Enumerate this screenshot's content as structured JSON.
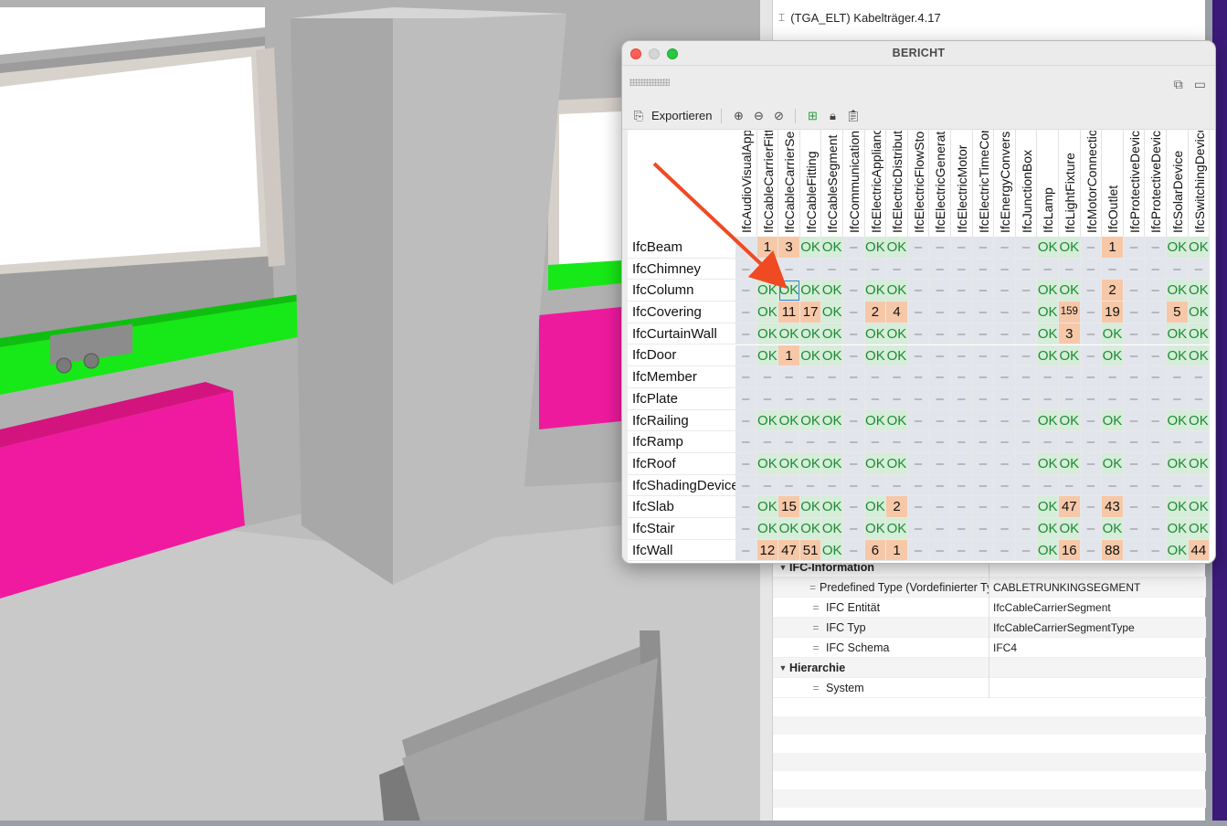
{
  "side_panel": {
    "tree_top_item": "(TGA_ELT) Kabelträger.4.17",
    "properties": [
      {
        "type": "group",
        "label": "IFC-Information"
      },
      {
        "type": "prop",
        "key": "Predefined Type (Vordefinierter Typ)",
        "value": "CABLETRUNKINGSEGMENT"
      },
      {
        "type": "prop",
        "key": "IFC Entität",
        "value": "IfcCableCarrierSegment"
      },
      {
        "type": "prop",
        "key": "IFC Typ",
        "value": "IfcCableCarrierSegmentType"
      },
      {
        "type": "prop",
        "key": "IFC Schema",
        "value": "IFC4"
      },
      {
        "type": "group",
        "label": "Hierarchie"
      },
      {
        "type": "prop",
        "key": "System",
        "value": ""
      }
    ]
  },
  "bericht": {
    "title": "BERICHT",
    "toolbar": {
      "export_label": "Exportieren"
    },
    "columns": [
      "IfcAudioVisualAppliance",
      "IfcCableCarrierFitting",
      "IfcCableCarrierSegment",
      "IfcCableFitting",
      "IfcCableSegment",
      "IfcCommunicationsAppliance",
      "IfcElectricAppliance",
      "IfcElectricDistributionBoard",
      "IfcElectricFlowStorageDevice",
      "IfcElectricGenerator",
      "IfcElectricMotor",
      "IfcElectricTimeControl",
      "IfcEnergyConversionDevice",
      "IfcJunctionBox",
      "IfcLamp",
      "IfcLightFixture",
      "IfcMotorConnection",
      "IfcOutlet",
      "IfcProtectiveDevice",
      "IfcProtectiveDeviceTrippingUnit",
      "IfcSolarDevice",
      "IfcSwitchingDevice"
    ],
    "rows": [
      {
        "label": "IfcBeam",
        "cells": [
          "",
          "1",
          "3",
          "OK",
          "OK",
          "–",
          "OK",
          "OK",
          "–",
          "–",
          "–",
          "–",
          "–",
          "–",
          "OK",
          "OK",
          "–",
          "1",
          "–",
          "–",
          "OK",
          "OK"
        ]
      },
      {
        "label": "IfcChimney",
        "cells": [
          "–",
          "–",
          "–",
          "–",
          "–",
          "–",
          "–",
          "–",
          "–",
          "–",
          "–",
          "–",
          "–",
          "–",
          "–",
          "–",
          "–",
          "–",
          "–",
          "–",
          "–",
          "–"
        ]
      },
      {
        "label": "IfcColumn",
        "cells": [
          "–",
          "OK",
          "OK",
          "OK",
          "OK",
          "–",
          "OK",
          "OK",
          "–",
          "–",
          "–",
          "–",
          "–",
          "–",
          "OK",
          "OK",
          "–",
          "2",
          "–",
          "–",
          "OK",
          "OK"
        ]
      },
      {
        "label": "IfcCovering",
        "cells": [
          "–",
          "OK",
          "11",
          "17",
          "OK",
          "–",
          "2",
          "4",
          "–",
          "–",
          "–",
          "–",
          "–",
          "–",
          "OK",
          "159",
          "–",
          "19",
          "–",
          "–",
          "5",
          "OK"
        ]
      },
      {
        "label": "IfcCurtainWall",
        "cells": [
          "–",
          "OK",
          "OK",
          "OK",
          "OK",
          "–",
          "OK",
          "OK",
          "–",
          "–",
          "–",
          "–",
          "–",
          "–",
          "OK",
          "3",
          "–",
          "OK",
          "–",
          "–",
          "OK",
          "OK"
        ]
      },
      {
        "label": "IfcDoor",
        "cells": [
          "–",
          "OK",
          "1",
          "OK",
          "OK",
          "–",
          "OK",
          "OK",
          "–",
          "–",
          "–",
          "–",
          "–",
          "–",
          "OK",
          "OK",
          "–",
          "OK",
          "–",
          "–",
          "OK",
          "OK"
        ]
      },
      {
        "label": "IfcMember",
        "cells": [
          "–",
          "–",
          "–",
          "–",
          "–",
          "–",
          "–",
          "–",
          "–",
          "–",
          "–",
          "–",
          "–",
          "–",
          "–",
          "–",
          "–",
          "–",
          "–",
          "–",
          "–",
          "–"
        ]
      },
      {
        "label": "IfcPlate",
        "cells": [
          "–",
          "–",
          "–",
          "–",
          "–",
          "–",
          "–",
          "–",
          "–",
          "–",
          "–",
          "–",
          "–",
          "–",
          "–",
          "–",
          "–",
          "–",
          "–",
          "–",
          "–",
          "–"
        ]
      },
      {
        "label": "IfcRailing",
        "cells": [
          "–",
          "OK",
          "OK",
          "OK",
          "OK",
          "–",
          "OK",
          "OK",
          "–",
          "–",
          "–",
          "–",
          "–",
          "–",
          "OK",
          "OK",
          "–",
          "OK",
          "–",
          "–",
          "OK",
          "OK"
        ]
      },
      {
        "label": "IfcRamp",
        "cells": [
          "–",
          "–",
          "–",
          "–",
          "–",
          "–",
          "–",
          "–",
          "–",
          "–",
          "–",
          "–",
          "–",
          "–",
          "–",
          "–",
          "–",
          "–",
          "–",
          "–",
          "–",
          "–"
        ]
      },
      {
        "label": "IfcRoof",
        "cells": [
          "–",
          "OK",
          "OK",
          "OK",
          "OK",
          "–",
          "OK",
          "OK",
          "–",
          "–",
          "–",
          "–",
          "–",
          "–",
          "OK",
          "OK",
          "–",
          "OK",
          "–",
          "–",
          "OK",
          "OK"
        ]
      },
      {
        "label": "IfcShadingDevice",
        "cells": [
          "–",
          "–",
          "–",
          "–",
          "–",
          "–",
          "–",
          "–",
          "–",
          "–",
          "–",
          "–",
          "–",
          "–",
          "–",
          "–",
          "–",
          "–",
          "–",
          "–",
          "–",
          "–"
        ]
      },
      {
        "label": "IfcSlab",
        "cells": [
          "–",
          "OK",
          "15",
          "OK",
          "OK",
          "–",
          "OK",
          "2",
          "–",
          "–",
          "–",
          "–",
          "–",
          "–",
          "OK",
          "47",
          "–",
          "43",
          "–",
          "–",
          "OK",
          "OK"
        ]
      },
      {
        "label": "IfcStair",
        "cells": [
          "–",
          "OK",
          "OK",
          "OK",
          "OK",
          "–",
          "OK",
          "OK",
          "–",
          "–",
          "–",
          "–",
          "–",
          "–",
          "OK",
          "OK",
          "–",
          "OK",
          "–",
          "–",
          "OK",
          "OK"
        ]
      },
      {
        "label": "IfcWall",
        "cells": [
          "–",
          "12",
          "47",
          "51",
          "OK",
          "–",
          "6",
          "1",
          "–",
          "–",
          "–",
          "–",
          "–",
          "–",
          "OK",
          "16",
          "–",
          "88",
          "–",
          "–",
          "OK",
          "44"
        ]
      }
    ],
    "selected_cell": {
      "row": 2,
      "col": 2
    }
  },
  "colors": {
    "ok_bg": "#d5edd9",
    "num_bg": "#f6c8a8",
    "dash_bg": "#e3e5ec",
    "accent_arrow": "#f04a22"
  }
}
